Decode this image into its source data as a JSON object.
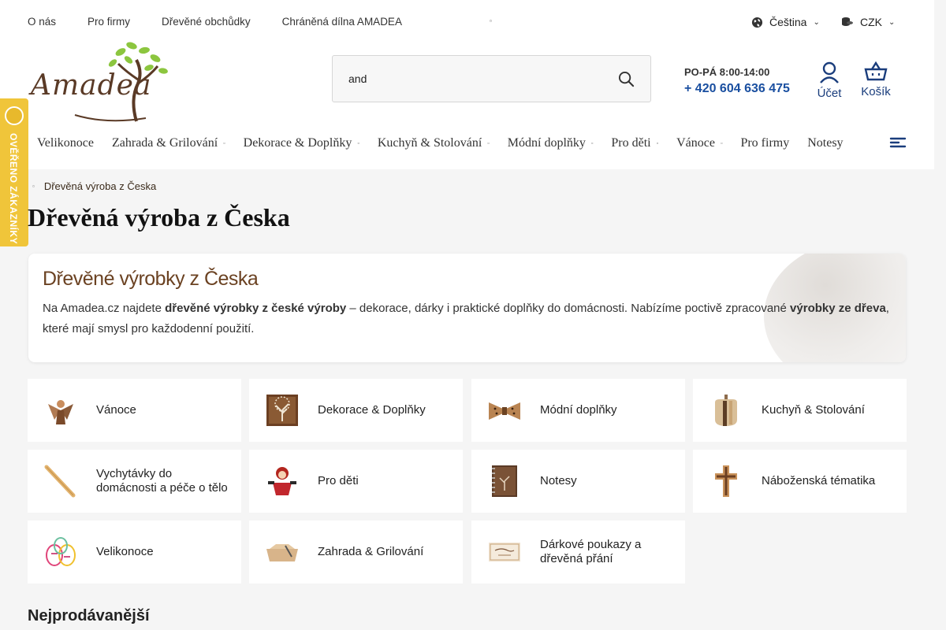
{
  "topnav": {
    "links": [
      "O nás",
      "Pro firmy",
      "Dřevěné obchůdky",
      "Chráněná dílna AMADEA"
    ],
    "tiny_glyph": "▫"
  },
  "language": {
    "label": "Čeština",
    "icon": "globe-icon"
  },
  "currency": {
    "label": "CZK",
    "icon": "coins-icon"
  },
  "logo": {
    "text": "Amadea"
  },
  "search": {
    "value": "and",
    "icon": "search-icon"
  },
  "contact": {
    "hours": "PO-PÁ 8:00-14:00",
    "phone": "+ 420 604 636 475"
  },
  "account": {
    "label": "Účet"
  },
  "cart": {
    "label": "Košík"
  },
  "side_badge": {
    "text": "OVĚŘENO ZÁKAZNÍKY"
  },
  "main_nav": [
    {
      "label": "Velikonoce",
      "has_sub": false
    },
    {
      "label": "Zahrada & Grilování",
      "has_sub": true
    },
    {
      "label": "Dekorace & Doplňky",
      "has_sub": true
    },
    {
      "label": "Kuchyň & Stolování",
      "has_sub": true
    },
    {
      "label": "Módní doplňky",
      "has_sub": true
    },
    {
      "label": "Pro děti",
      "has_sub": true
    },
    {
      "label": "Vánoce",
      "has_sub": true
    },
    {
      "label": "Pro firmy",
      "has_sub": false
    },
    {
      "label": "Notesy",
      "has_sub": false
    }
  ],
  "breadcrumb": {
    "current": "Dřevěná výroba z Česka"
  },
  "page_title": "Dřevěná výroba z Česka",
  "intro": {
    "heading": "Dřevěné výrobky z Česka",
    "p_part1": "Na Amadea.cz najdete ",
    "p_bold1": "dřevěné výrobky z české výroby",
    "p_part2": " – dekorace, dárky i praktické doplňky do domácnosti. Nabízíme poctivě zpracované ",
    "p_bold2": "výrobky ze dřeva",
    "p_part3": ", které mají smysl pro každodenní použití."
  },
  "categories": [
    {
      "label": "Vánoce",
      "icon": "angel-ornament-icon"
    },
    {
      "label": "Dekorace & Doplňky",
      "icon": "tree-picture-icon"
    },
    {
      "label": "Módní doplňky",
      "icon": "bow-tie-icon"
    },
    {
      "label": "Kuchyň & Stolování",
      "icon": "cutting-board-icon"
    },
    {
      "label": "Vychytávky do domácnosti a péče o tělo",
      "icon": "wooden-stick-icon"
    },
    {
      "label": "Pro děti",
      "icon": "puppet-icon"
    },
    {
      "label": "Notesy",
      "icon": "notebook-icon"
    },
    {
      "label": "Náboženská tématika",
      "icon": "cross-icon"
    },
    {
      "label": "Velikonoce",
      "icon": "easter-eggs-icon"
    },
    {
      "label": "Zahrada & Grilování",
      "icon": "garden-box-icon"
    },
    {
      "label": "Dárkové poukazy a dřevěná přání",
      "icon": "gift-card-icon"
    }
  ],
  "bestsellers": {
    "heading": "Nejprodávanější"
  }
}
